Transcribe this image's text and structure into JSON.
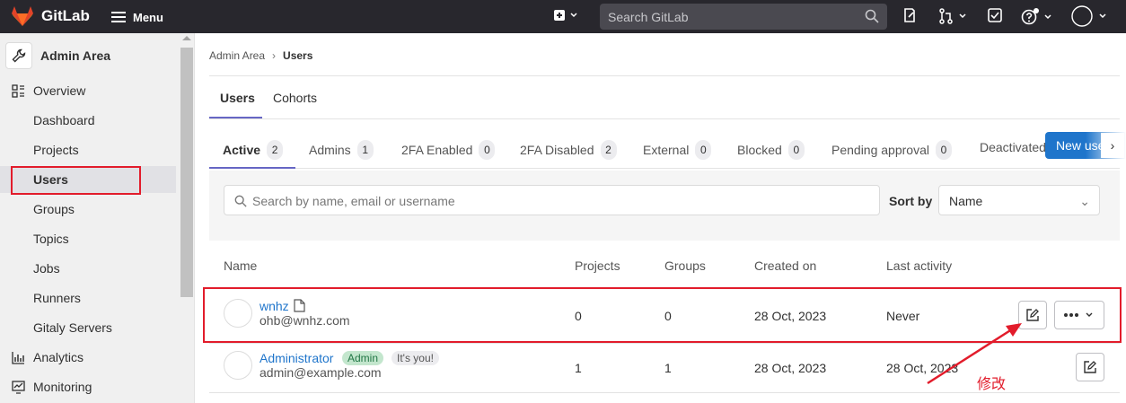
{
  "topbar": {
    "app_name": "GitLab",
    "menu_label": "Menu",
    "search_placeholder": "Search GitLab"
  },
  "sidebar": {
    "header_label": "Admin Area",
    "overview_label": "Overview",
    "items": [
      {
        "label": "Dashboard"
      },
      {
        "label": "Projects"
      },
      {
        "label": "Users"
      },
      {
        "label": "Groups"
      },
      {
        "label": "Topics"
      },
      {
        "label": "Jobs"
      },
      {
        "label": "Runners"
      },
      {
        "label": "Gitaly Servers"
      }
    ],
    "analytics_label": "Analytics",
    "monitoring_label": "Monitoring"
  },
  "breadcrumb": {
    "parent": "Admin Area",
    "current": "Users"
  },
  "page_tabs": [
    {
      "label": "Users"
    },
    {
      "label": "Cohorts"
    }
  ],
  "filter_tabs": [
    {
      "label": "Active",
      "count": "2"
    },
    {
      "label": "Admins",
      "count": "1"
    },
    {
      "label": "2FA Enabled",
      "count": "0"
    },
    {
      "label": "2FA Disabled",
      "count": "2"
    },
    {
      "label": "External",
      "count": "0"
    },
    {
      "label": "Blocked",
      "count": "0"
    },
    {
      "label": "Pending approval",
      "count": "0"
    },
    {
      "label": "Deactivated",
      "count": ""
    }
  ],
  "new_user_label": "New user",
  "search": {
    "placeholder": "Search by name, email or username"
  },
  "sort": {
    "label": "Sort by",
    "value": "Name"
  },
  "table": {
    "headers": [
      "Name",
      "Projects",
      "Groups",
      "Created on",
      "Last activity"
    ],
    "rows": [
      {
        "name": "wnhz",
        "email": "ohb@wnhz.com",
        "projects": "0",
        "groups": "0",
        "created": "28 Oct, 2023",
        "last_activity": "Never"
      },
      {
        "name": "Administrator",
        "badge_admin": "Admin",
        "badge_you": "It's you!",
        "email": "admin@example.com",
        "projects": "1",
        "groups": "1",
        "created": "28 Oct, 2023",
        "last_activity": "28 Oct, 2023"
      }
    ]
  },
  "annotation_text": "修改",
  "colors": {
    "accent": "#1f75cb",
    "annotation": "#e21c2b",
    "topbar": "#28272d"
  }
}
